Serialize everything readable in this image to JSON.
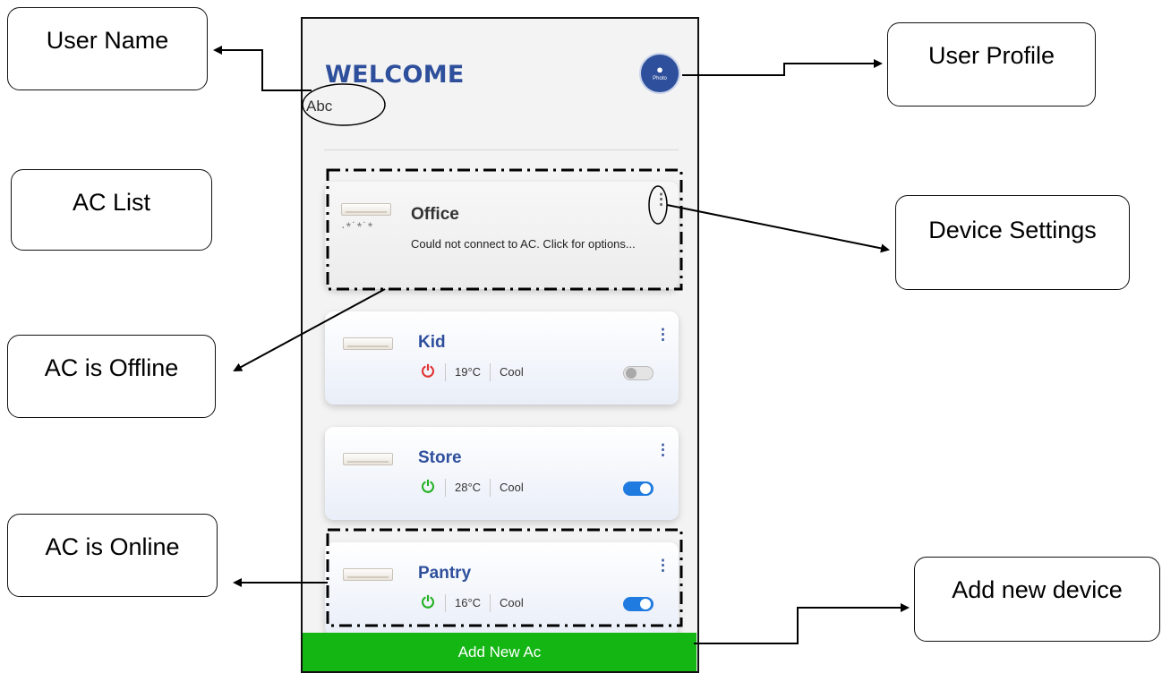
{
  "callouts": {
    "user_name": "User Name",
    "user_profile": "User Profile",
    "ac_list": "AC List",
    "device_settings": "Device Settings",
    "ac_offline": "AC is Offline",
    "ac_online": "AC is Online",
    "add_new_device": "Add new device"
  },
  "app": {
    "welcome": "WELCOME",
    "username": "Abc",
    "avatar_label": "Photo",
    "add_button": "Add New Ac"
  },
  "devices": [
    {
      "name": "Office",
      "status": "offline",
      "message": "Could not connect to AC. Click for options..."
    },
    {
      "name": "Kid",
      "status": "online",
      "power": "off",
      "temp": "19°C",
      "mode": "Cool",
      "toggle": "off"
    },
    {
      "name": "Store",
      "status": "online",
      "power": "on",
      "temp": "28°C",
      "mode": "Cool",
      "toggle": "on"
    },
    {
      "name": "Pantry",
      "status": "online",
      "power": "on",
      "temp": "16°C",
      "mode": "Cool",
      "toggle": "on"
    }
  ],
  "colors": {
    "brand_blue": "#2e4f9c",
    "power_off": "#e03030",
    "power_on": "#22b022",
    "toggle_on": "#1f7be0",
    "add_button": "#13b613"
  },
  "icons": {
    "avatar": "camera-icon",
    "menu": "vertical-dots-icon",
    "power": "power-icon"
  }
}
